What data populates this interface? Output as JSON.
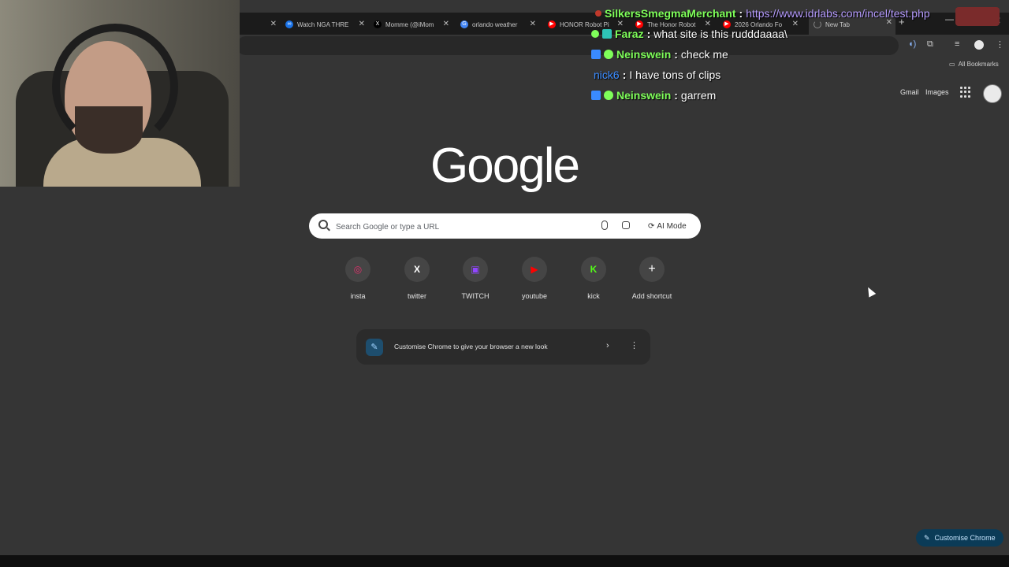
{
  "tabs": [
    {
      "label": "Watch NGA THRE",
      "fav_color": "#1a73e8"
    },
    {
      "label": "Momme (@iMom",
      "fav_color": "#000000"
    },
    {
      "label": "orlando weather",
      "fav_color": "#4285f4"
    },
    {
      "label": "HONOR Robot Pi",
      "fav_color": "#ff0000"
    },
    {
      "label": "The Honor Robot",
      "fav_color": "#ff0000"
    },
    {
      "label": "2026 Orlando Fo",
      "fav_color": "#ff0000"
    },
    {
      "label": "New Tab",
      "fav_color": "#888888"
    }
  ],
  "toolbar": {
    "all_bookmarks": "All Bookmarks"
  },
  "header_links": {
    "gmail": "Gmail",
    "images": "Images"
  },
  "logo": "Google",
  "search": {
    "placeholder": "Search Google or type a URL",
    "ai_mode": "AI Mode"
  },
  "shortcuts": [
    {
      "label": "insta",
      "icon": "instagram-icon",
      "color": "#e1306c",
      "glyph": "◎"
    },
    {
      "label": "twitter",
      "icon": "x-icon",
      "color": "#ffffff",
      "glyph": "𝕏"
    },
    {
      "label": "TWITCH",
      "icon": "twitch-icon",
      "color": "#9146ff",
      "glyph": "▣"
    },
    {
      "label": "youtube",
      "icon": "youtube-icon",
      "color": "#ff0000",
      "glyph": "▶"
    },
    {
      "label": "kick",
      "icon": "kick-icon",
      "color": "#53fc18",
      "glyph": "K"
    },
    {
      "label": "Add shortcut",
      "icon": "plus-icon",
      "color": "#ffffff",
      "glyph": "+"
    }
  ],
  "customise_card": {
    "text": "Customise Chrome to give your browser a new look"
  },
  "customise_button": "Customise Chrome",
  "chat": [
    {
      "user": "SilkersSmegmaMerchant",
      "user_color": "#7fff5a",
      "message": "https://www.idrlabs.com/incel/test.php",
      "message_color": "#b69cff"
    },
    {
      "user": "Faraz",
      "user_color": "#7fff5a",
      "message": "what site is this rudddaaaa\\",
      "message_color": "#ffffff"
    },
    {
      "user": "Neinswein",
      "user_color": "#7fff5a",
      "message": "check me",
      "message_color": "#ffffff"
    },
    {
      "user": "nick6",
      "user_color": "#3a8bff",
      "message": "I have tons of clips",
      "message_color": "#ffffff"
    },
    {
      "user": "Neinswein",
      "user_color": "#7fff5a",
      "message": "garrem",
      "message_color": "#ffffff"
    }
  ]
}
